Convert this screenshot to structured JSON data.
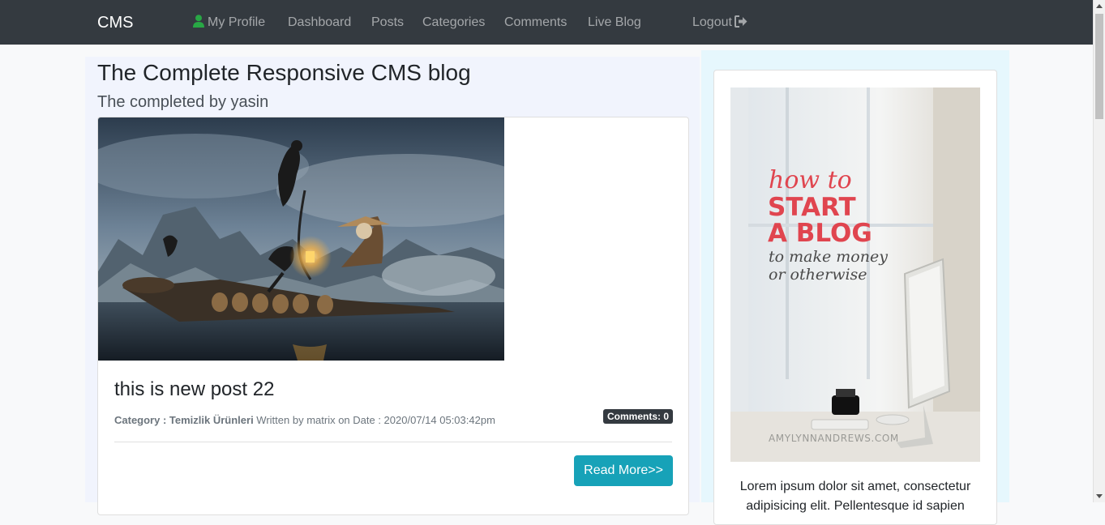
{
  "navbar": {
    "brand": "CMS",
    "items": [
      {
        "label": "My Profile",
        "icon": "user-icon"
      },
      {
        "label": "Dashboard"
      },
      {
        "label": "Posts"
      },
      {
        "label": "Categories"
      },
      {
        "label": "Comments"
      },
      {
        "label": "Live Blog"
      }
    ],
    "logout": {
      "label": "Logout",
      "icon": "sign-out-icon"
    }
  },
  "main": {
    "title": "The Complete Responsive CMS blog",
    "lead": "The completed by yasin",
    "post": {
      "image_alt": "Fisherman with cormorants on a bamboo raft",
      "title": "this is new post 22",
      "category_label": "Category : Temizlik Ürünleri",
      "meta": " Written by matrix on Date : 2020/07/14 05:03:42pm",
      "comments_badge": "Comments: 0",
      "read_more": "Read More>>"
    }
  },
  "sidebar": {
    "image": {
      "line1": "how to",
      "line2": "START",
      "line3": "A BLOG",
      "line4": "to make money",
      "line5": "or otherwise",
      "watermark": "AMYLYNNANDREWS.COM"
    },
    "text": "Lorem ipsum dolor sit amet, consectetur adipisicing elit. Pellentesque id sapien"
  },
  "colors": {
    "navbar_bg": "#343a40",
    "main_bg": "#f1f4fd",
    "sidebar_bg": "#e6f7fd",
    "button": "#17a2b8",
    "user_icon": "#28a745"
  }
}
